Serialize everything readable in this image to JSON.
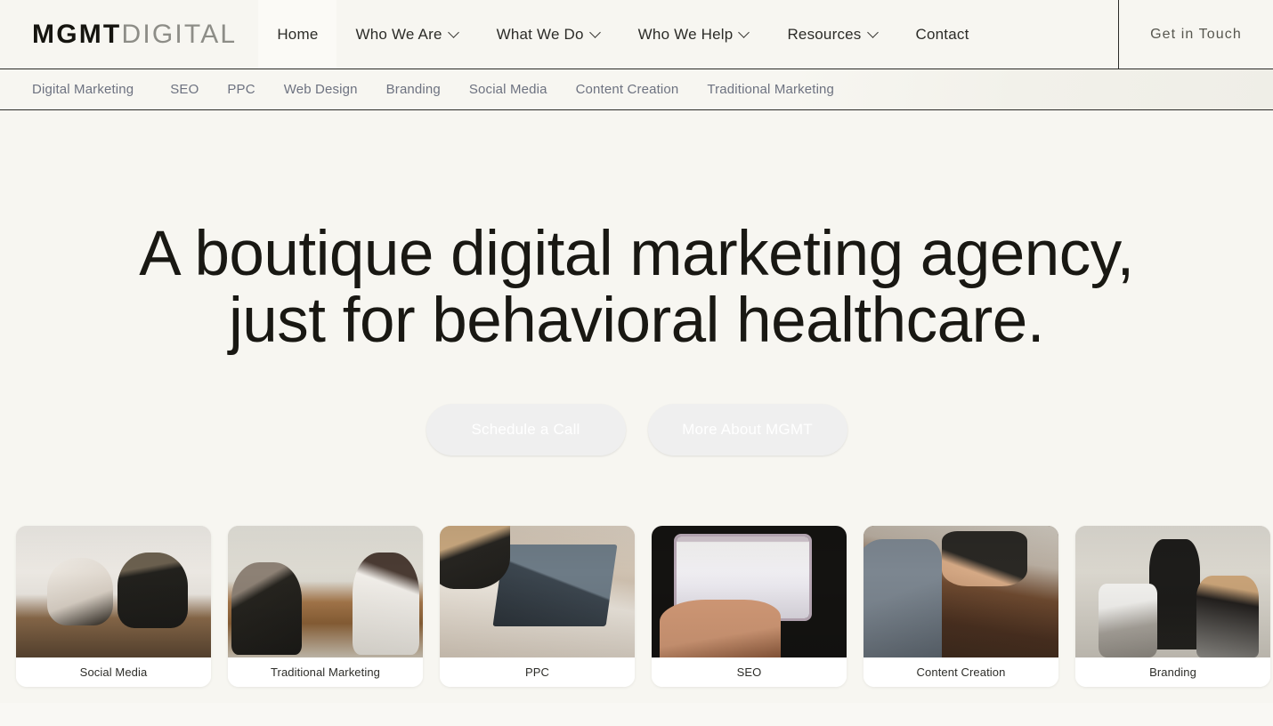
{
  "brand": {
    "bold": "MGMT",
    "light": "DIGITAL"
  },
  "header": {
    "nav": [
      {
        "label": "Home",
        "caret": false,
        "active": true
      },
      {
        "label": "Who We Are",
        "caret": true,
        "active": false
      },
      {
        "label": "What We Do",
        "caret": true,
        "active": false
      },
      {
        "label": "Who We Help",
        "caret": true,
        "active": false
      },
      {
        "label": "Resources",
        "caret": true,
        "active": false
      },
      {
        "label": "Contact",
        "caret": false,
        "active": false
      }
    ],
    "cta": "Get in Touch"
  },
  "subnav": {
    "items": [
      {
        "label": "Digital Marketing"
      },
      {
        "label": "SEO"
      },
      {
        "label": "PPC"
      },
      {
        "label": "Web Design"
      },
      {
        "label": "Branding"
      },
      {
        "label": "Social Media"
      },
      {
        "label": "Content Creation"
      },
      {
        "label": "Traditional Marketing"
      }
    ]
  },
  "hero": {
    "headline_line1": "A boutique digital marketing agency,",
    "headline_line2": "just for behavioral healthcare.",
    "buttons": [
      {
        "label": "Schedule a Call"
      },
      {
        "label": "More About MGMT"
      }
    ]
  },
  "cards": [
    {
      "label": "Social Media"
    },
    {
      "label": "Traditional Marketing"
    },
    {
      "label": "PPC"
    },
    {
      "label": "SEO"
    },
    {
      "label": "Content Creation"
    },
    {
      "label": "Branding"
    }
  ],
  "colors": {
    "background": "#f7f6f1",
    "ink": "#191813",
    "muted": "#6d7280",
    "cta_dark": "#9a4f27",
    "cta_light": "#ef954a",
    "rule": "#2b2b28"
  }
}
